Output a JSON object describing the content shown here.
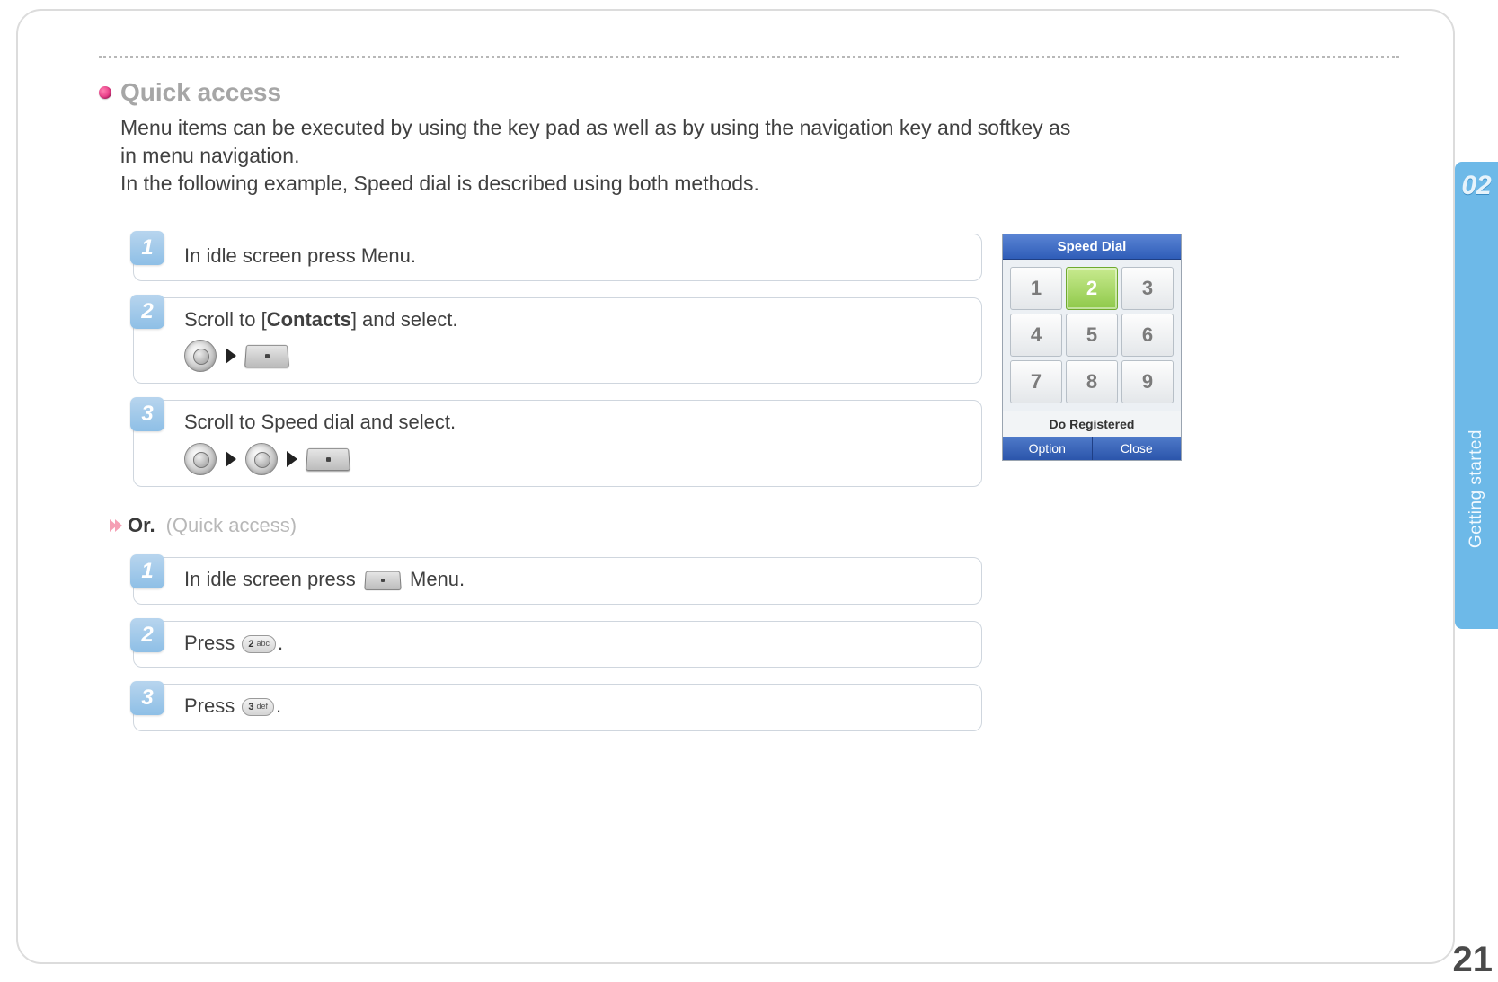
{
  "section": {
    "title": "Quick access",
    "intro_line1": "Menu items can be executed by using the key pad as well as by using the navigation key and softkey as in menu navigation.",
    "intro_line2": "In the following example, Speed dial is described using both methods."
  },
  "method_a": {
    "steps": [
      {
        "num": "1",
        "text_before": "In idle screen press Menu.",
        "icons": []
      },
      {
        "num": "2",
        "text_before": "Scroll to [",
        "bold": "Contacts",
        "text_after": "] and select.",
        "icons": [
          "wheel",
          "tri",
          "softkey"
        ]
      },
      {
        "num": "3",
        "text_before": "Scroll to Speed dial and select.",
        "icons": [
          "wheel",
          "tri",
          "wheel",
          "tri",
          "softkey"
        ]
      }
    ]
  },
  "or": {
    "label": "Or.",
    "sub": "(Quick access)"
  },
  "method_b": {
    "steps": [
      {
        "num": "1",
        "segments": [
          "In idle screen press ",
          {
            "type": "softkey"
          },
          " Menu."
        ]
      },
      {
        "num": "2",
        "segments": [
          "Press ",
          {
            "type": "key",
            "digit": "2",
            "letters": "abc"
          },
          "."
        ]
      },
      {
        "num": "3",
        "segments": [
          "Press ",
          {
            "type": "key",
            "digit": "3",
            "letters": "def"
          },
          "."
        ]
      }
    ]
  },
  "phone": {
    "title": "Speed  Dial",
    "cells": [
      "1",
      "2",
      "3",
      "4",
      "5",
      "6",
      "7",
      "8",
      "9"
    ],
    "selected_index": 1,
    "status": "Do  Registered",
    "soft_left": "Option",
    "soft_right": "Close"
  },
  "side": {
    "chapter": "02",
    "label": "Getting started"
  },
  "page_number": "21"
}
